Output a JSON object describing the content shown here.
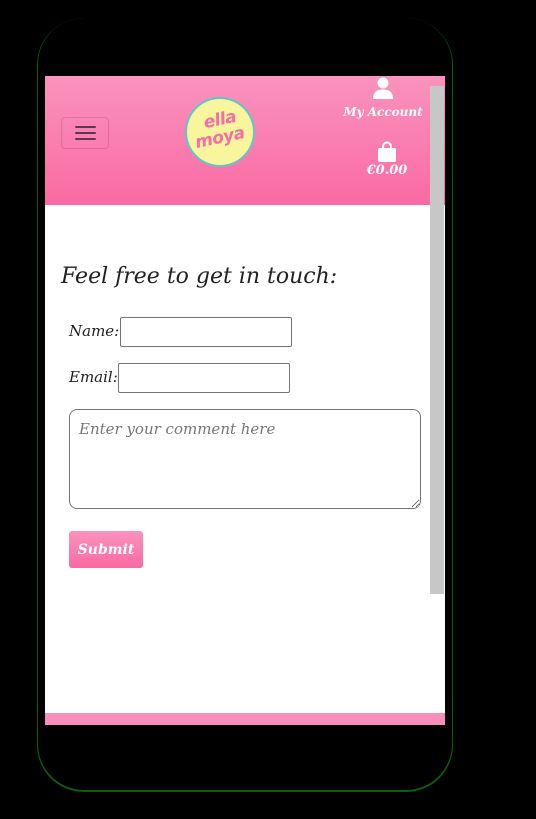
{
  "header": {
    "logo": {
      "line1": "ella",
      "line2": "moya",
      "color": "#f56fa6",
      "bg": "#f8f59d"
    },
    "menu_icon": "hamburger-menu-icon",
    "account": {
      "icon": "user-icon",
      "label": "My Account"
    },
    "cart": {
      "icon": "shopping-bag-icon",
      "total": "€0.00"
    },
    "colors": {
      "gradient_top": "#f993bd",
      "gradient_bottom": "#fa6aa2"
    }
  },
  "contact": {
    "title": "Feel free to get in touch:",
    "name_label": "Name:",
    "name_value": "",
    "email_label": "Email:",
    "email_value": "",
    "comment_placeholder": "Enter your comment here",
    "comment_value": "",
    "submit_label": "Submit"
  }
}
